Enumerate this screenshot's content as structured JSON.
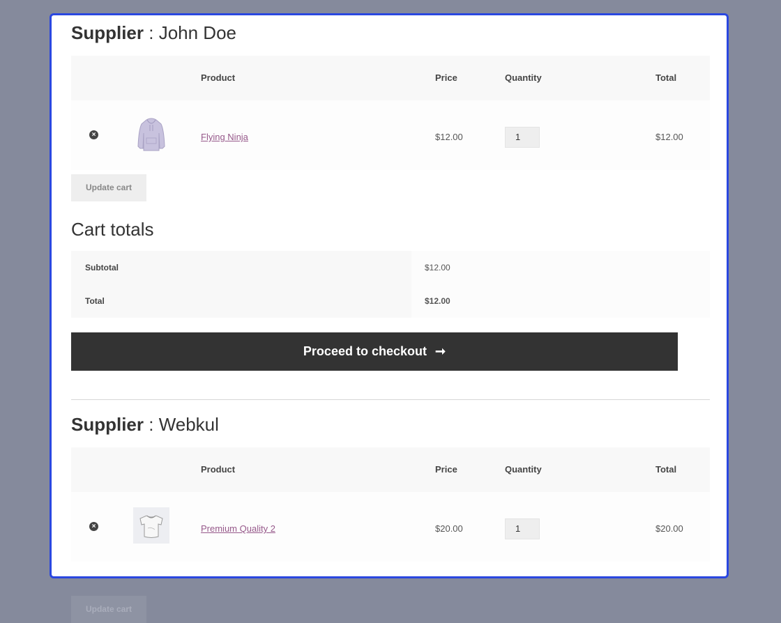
{
  "suppliers": [
    {
      "label": "Supplier",
      "separator": " : ",
      "name": "John Doe",
      "headers": {
        "product": "Product",
        "price": "Price",
        "quantity": "Quantity",
        "total": "Total"
      },
      "item": {
        "icon": "hoodie-image",
        "name": "Flying Ninja",
        "price": "$12.00",
        "quantity": "1",
        "total": "$12.00"
      },
      "update_label": "Update cart"
    },
    {
      "label": "Supplier",
      "separator": " : ",
      "name": "Webkul",
      "headers": {
        "product": "Product",
        "price": "Price",
        "quantity": "Quantity",
        "total": "Total"
      },
      "item": {
        "icon": "tshirt-image",
        "name": "Premium Quality 2",
        "price": "$20.00",
        "quantity": "1",
        "total": "$20.00"
      },
      "update_label": "Update cart"
    }
  ],
  "cart_totals": {
    "title": "Cart totals",
    "subtotal_label": "Subtotal",
    "subtotal_value": "$12.00",
    "total_label": "Total",
    "total_value": "$12.00"
  },
  "checkout": {
    "label": "Proceed to checkout",
    "arrow": "➞"
  },
  "remove_glyph": "×",
  "colors": {
    "frame_border": "#2a47e0",
    "link": "#96588a",
    "checkout_bg": "#333333",
    "backdrop": "#858a9c"
  }
}
